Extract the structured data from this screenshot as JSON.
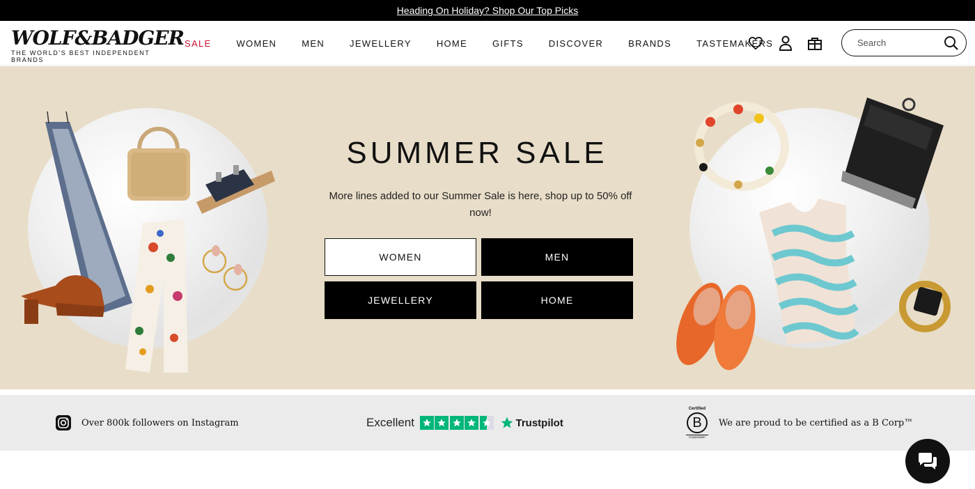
{
  "announcement": {
    "text": "Heading On Holiday? Shop Our Top Picks"
  },
  "brand": {
    "logo_text": "WOLF&BADGER",
    "tagline": "THE WORLD'S BEST INDEPENDENT BRANDS"
  },
  "nav": {
    "items": [
      {
        "label": "SALE",
        "highlight": true
      },
      {
        "label": "WOMEN"
      },
      {
        "label": "MEN"
      },
      {
        "label": "JEWELLERY"
      },
      {
        "label": "HOME"
      },
      {
        "label": "GIFTS"
      },
      {
        "label": "DISCOVER"
      },
      {
        "label": "BRANDS"
      },
      {
        "label": "TASTEMAKERS"
      }
    ],
    "sale_color": "#c8102e"
  },
  "header_icons": [
    "heart-icon",
    "user-icon",
    "bag-icon"
  ],
  "search": {
    "placeholder": "Search",
    "icon": "search-icon"
  },
  "hero": {
    "title": "SUMMER SALE",
    "description": "More lines added to our Summer Sale is here, shop up to 50% off now!",
    "background": "#e8ddc8",
    "buttons": [
      {
        "label": "WOMEN",
        "style": "light"
      },
      {
        "label": "MEN",
        "style": "dark"
      },
      {
        "label": "JEWELLERY",
        "style": "dark"
      },
      {
        "label": "HOME",
        "style": "dark"
      }
    ]
  },
  "trust_bar": {
    "instagram": {
      "text": "Over 800k followers on Instagram",
      "icon": "instagram-icon"
    },
    "trustpilot": {
      "rating_word": "Excellent",
      "stars": 4.5,
      "brand": "Trustpilot",
      "color": "#00b67a"
    },
    "bcorp": {
      "text": "We are proud to be certified as a B Corp™",
      "badge_top": "Certified",
      "badge_letter": "B",
      "badge_bottom": "Corporation"
    }
  },
  "chat": {
    "icon": "chat-icon"
  }
}
